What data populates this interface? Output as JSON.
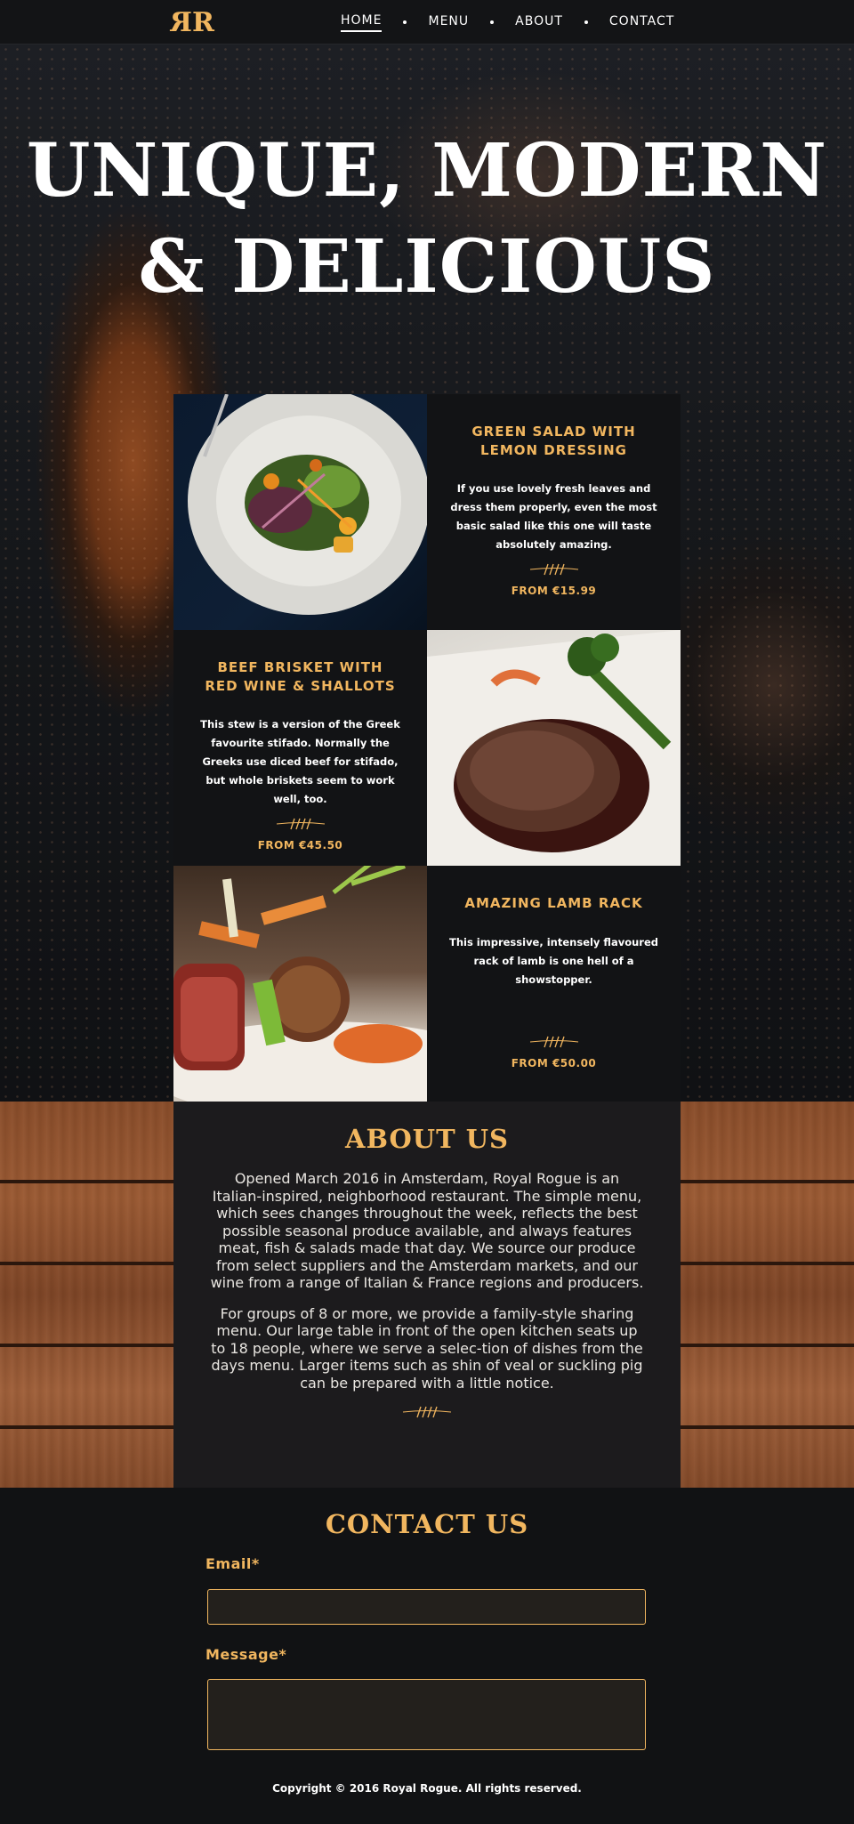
{
  "nav": {
    "logo": "RR",
    "links": [
      "HOME",
      "MENU",
      "ABOUT",
      "CONTACT"
    ],
    "active": "HOME"
  },
  "hero": {
    "title_line1": "UNIQUE, MODERN",
    "title_line2": "& DELICIOUS"
  },
  "menu": {
    "items": [
      {
        "title_line1": "GREEN SALAD WITH",
        "title_line2": "LEMON DRESSING",
        "description": "If you use lovely fresh leaves and dress them properly, even the most basic salad like this one will taste absolutely amazing.",
        "price": "FROM €15.99"
      },
      {
        "title_line1": "BEEF BRISKET WITH",
        "title_line2": "RED WINE & SHALLOTS",
        "description": "This stew is a version of the Greek favourite stifado. Normally the Greeks use diced beef for stifado, but whole briskets seem to work well, too.",
        "price": "FROM €45.50"
      },
      {
        "title_line1": "AMAZING LAMB RACK",
        "title_line2": "",
        "description": "This impressive, intensely flavoured rack of lamb is one hell of a showstopper.",
        "price": "FROM €50.00"
      }
    ]
  },
  "about": {
    "title": "ABOUT US",
    "paragraph1": "Opened March 2016 in Amsterdam, Royal Rogue is an Italian-inspired, neighborhood restaurant. The simple menu, which sees changes throughout the week, reflects the best possible seasonal produce available, and always features meat, fish & salads made that day. We source our produce from select suppliers and the Amsterdam markets, and our wine from a range of Italian & France regions and producers.",
    "paragraph2": "For groups of 8 or more, we provide a family-style sharing menu. Our large table in front of the open kitchen seats up to 18 people, where we serve a selec-tion of dishes from the days menu. Larger items such as shin of veal or suckling pig can be prepared with a little notice."
  },
  "contact": {
    "title": "CONTACT US",
    "email_label": "Email*",
    "email_value": "",
    "message_label": "Message*",
    "message_value": ""
  },
  "footer": {
    "copyright": "Copyright © 2016 Royal Rogue. All rights reserved."
  },
  "colors": {
    "accent": "#f1b65f",
    "background": "#111214",
    "panel": "#121315",
    "about_panel": "#1c1b1d"
  }
}
